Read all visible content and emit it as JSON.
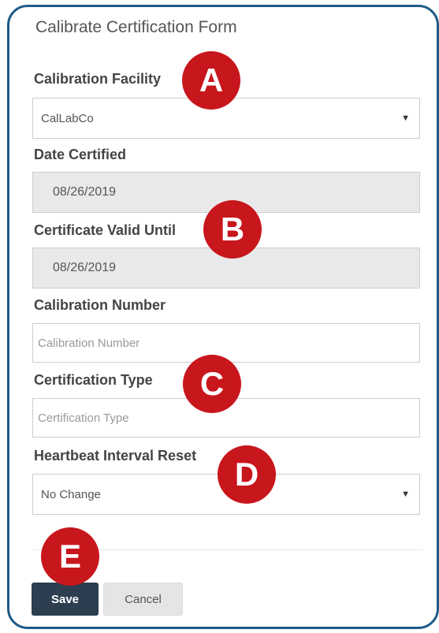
{
  "form": {
    "title": "Calibrate Certification Form",
    "calibration_facility": {
      "label": "Calibration Facility",
      "value": "CalLabCo"
    },
    "date_certified": {
      "label": "Date Certified",
      "value": "08/26/2019"
    },
    "certificate_valid_until": {
      "label": "Certificate Valid Until",
      "value": "08/26/2019"
    },
    "calibration_number": {
      "label": "Calibration Number",
      "placeholder": "Calibration Number"
    },
    "certification_type": {
      "label": "Certification Type",
      "placeholder": "Certification Type"
    },
    "heartbeat_interval_reset": {
      "label": "Heartbeat Interval Reset",
      "value": "No Change"
    },
    "save_label": "Save",
    "cancel_label": "Cancel"
  },
  "markers": [
    "A",
    "B",
    "C",
    "D",
    "E"
  ],
  "colors": {
    "border": "#1e5a86",
    "marker": "#c8161d",
    "save_button": "#2c3e50"
  }
}
